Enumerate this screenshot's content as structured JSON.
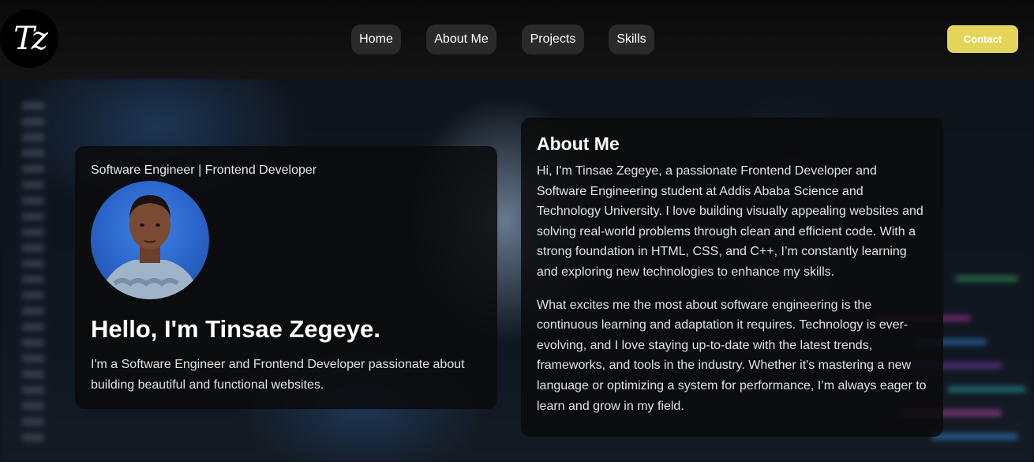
{
  "header": {
    "logo_text": "Tz",
    "nav": [
      {
        "label": "Home"
      },
      {
        "label": "About Me"
      },
      {
        "label": "Projects"
      },
      {
        "label": "Skills"
      }
    ],
    "contact_label": "Contact",
    "colors": {
      "contact_bg": "#e2d55a",
      "nav_bg": "#2a2a2a"
    }
  },
  "hero": {
    "tagline": "Software Engineer | Frontend Developer",
    "title": "Hello, I'm Tinsae Zegeye.",
    "description": "I'm a Software Engineer and Frontend Developer passionate about building beautiful and functional websites."
  },
  "about": {
    "title": "About Me",
    "paragraphs": [
      "Hi, I'm Tinsae Zegeye, a passionate Frontend Developer and Software Engineering student at Addis Ababa Science and Technology University. I love building visually appealing websites and solving real-world problems through clean and efficient code. With a strong foundation in HTML, CSS, and C++, I’m constantly learning and exploring new technologies to enhance my skills.",
      "What excites me the most about software engineering is the continuous learning and adaptation it requires. Technology is ever-evolving, and I love staying up-to-date with the latest trends, frameworks, and tools in the industry. Whether it's mastering a new language or optimizing a system for performance, I’m always eager to learn and grow in my field."
    ]
  }
}
